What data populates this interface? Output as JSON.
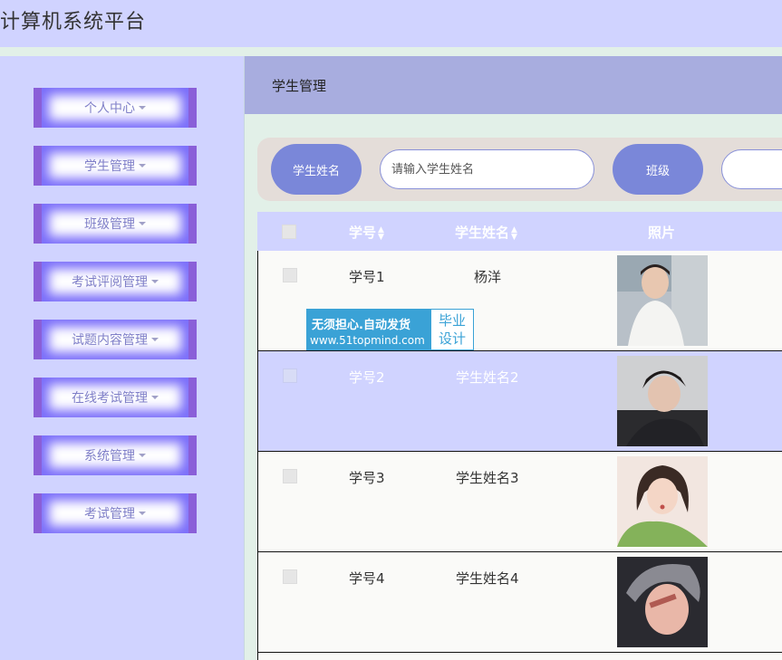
{
  "app": {
    "title": "计算机系统平台"
  },
  "sidebar": {
    "items": [
      {
        "label": "个人中心"
      },
      {
        "label": "学生管理"
      },
      {
        "label": "班级管理"
      },
      {
        "label": "考试评阅管理"
      },
      {
        "label": "试题内容管理"
      },
      {
        "label": "在线考试管理"
      },
      {
        "label": "系统管理"
      },
      {
        "label": "考试管理"
      }
    ]
  },
  "breadcrumb": {
    "title": "学生管理"
  },
  "search": {
    "name_label": "学生姓名",
    "name_placeholder": "请输入学生姓名",
    "class_label": "班级"
  },
  "table": {
    "columns": {
      "id": "学号",
      "name": "学生姓名",
      "photo": "照片"
    },
    "rows": [
      {
        "id": "学号1",
        "name": "杨洋",
        "highlight": false
      },
      {
        "id": "学号2",
        "name": "学生姓名2",
        "highlight": true
      },
      {
        "id": "学号3",
        "name": "学生姓名3",
        "highlight": false
      },
      {
        "id": "学号4",
        "name": "学生姓名4",
        "highlight": false
      }
    ]
  },
  "watermark": {
    "line1": "无须担心.自动发货",
    "line2": "www.51topmind.com",
    "side_top": "毕业",
    "side_bottom": "设计"
  },
  "colors": {
    "page_bg": "#d0d3ff",
    "accent": "#7a87d9",
    "sidebar_border": "#8a5fd8",
    "header_bar": "#a8addf",
    "row_highlight": "#d0d3ff",
    "row_default": "#fafaf8"
  }
}
